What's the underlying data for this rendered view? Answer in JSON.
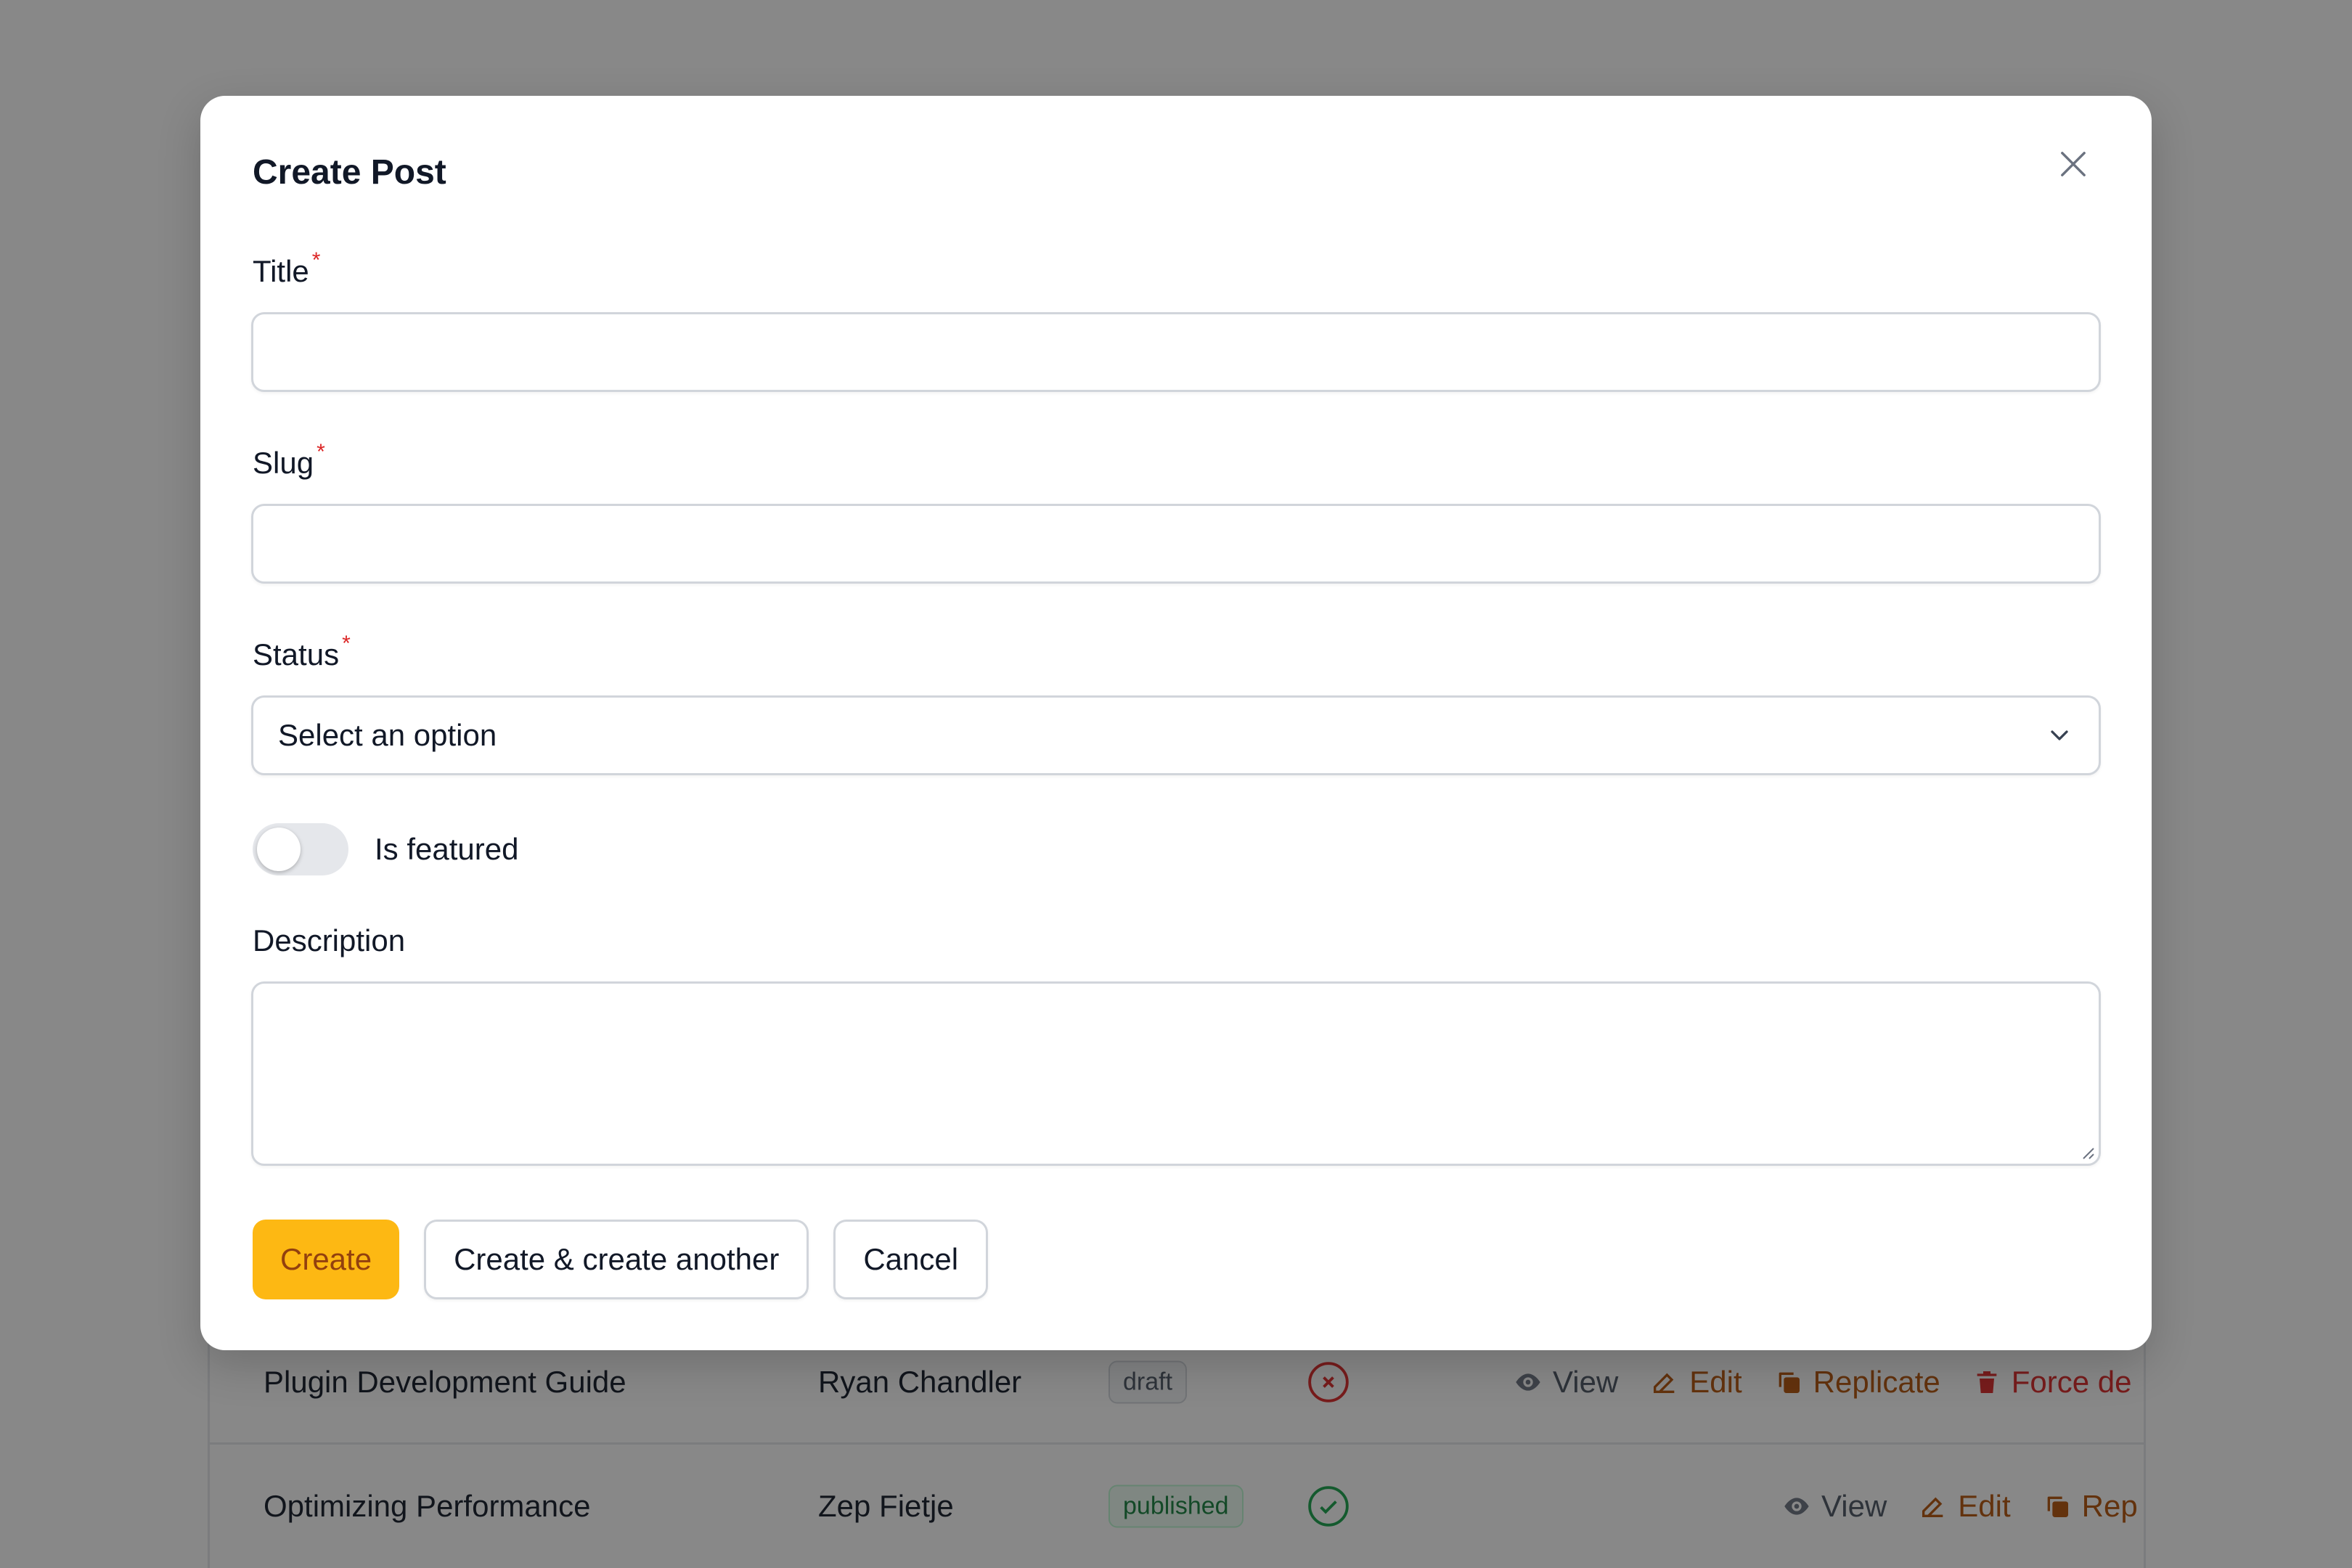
{
  "modal": {
    "title": "Create Post",
    "fields": {
      "title": {
        "label": "Title",
        "required": "*",
        "value": ""
      },
      "slug": {
        "label": "Slug",
        "required": "*",
        "value": ""
      },
      "status": {
        "label": "Status",
        "required": "*",
        "selected": "Select an option"
      },
      "featured": {
        "label": "Is featured",
        "on": false
      },
      "description": {
        "label": "Description",
        "value": ""
      }
    },
    "buttons": {
      "create": "Create",
      "create_another": "Create & create another",
      "cancel": "Cancel"
    }
  },
  "table": {
    "rows": [
      {
        "title": "Plugin Development Guide",
        "author": "Ryan Chandler",
        "status": "draft",
        "featured_icon": "x-circle-icon",
        "actions": [
          "View",
          "Edit",
          "Replicate",
          "Force de"
        ]
      },
      {
        "title": "Optimizing Performance",
        "author": "Zep Fietje",
        "status": "published",
        "featured_icon": "check-circle-icon",
        "actions": [
          "View",
          "Edit",
          "Rep"
        ]
      }
    ]
  },
  "colors": {
    "primary": "#fdb813",
    "primary_text": "#92400e",
    "required": "#dc2626",
    "overlay": "rgba(17,17,17,0.5)"
  }
}
